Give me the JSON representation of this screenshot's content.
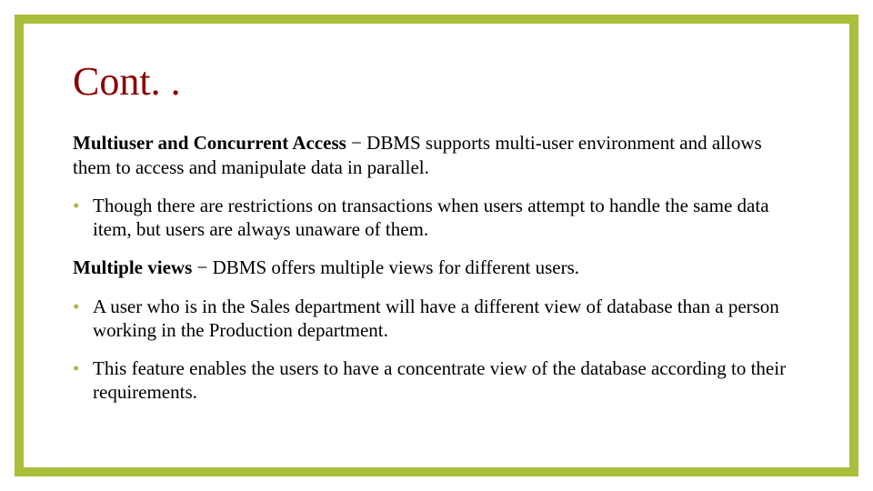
{
  "slide": {
    "title": "Cont. .",
    "sections": [
      {
        "heading": "Multiuser and Concurrent Access",
        "intro": " − DBMS supports multi-user environment and allows them to access and manipulate data in parallel.",
        "bullets": [
          "Though there are restrictions on transactions when users attempt to handle the same data item, but users are always unaware of them."
        ]
      },
      {
        "heading": "Multiple views",
        "intro": " − DBMS offers multiple views for different users.",
        "bullets": [
          " A user who is in the Sales department will have a different view of database than a person working in the Production department.",
          " This feature enables the users to have a concentrate view of the database according to their requirements."
        ]
      }
    ]
  }
}
